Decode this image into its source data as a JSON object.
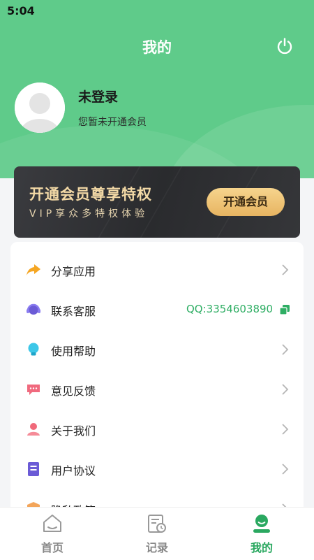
{
  "status_bar": {
    "time": "5:04"
  },
  "header": {
    "title": "我的"
  },
  "profile": {
    "name": "未登录",
    "subtitle": "您暂未开通会员"
  },
  "vip_banner": {
    "title": "开通会员尊享特权",
    "subtitle": "VIP享众多特权体验",
    "button_label": "开通会员"
  },
  "menu": {
    "items": [
      {
        "label": "分享应用",
        "icon": "share-arrow-icon"
      },
      {
        "label": "联系客服",
        "icon": "headset-icon",
        "extra": "QQ:3354603890"
      },
      {
        "label": "使用帮助",
        "icon": "lightbulb-icon"
      },
      {
        "label": "意见反馈",
        "icon": "chat-bubble-icon"
      },
      {
        "label": "关于我们",
        "icon": "person-icon"
      },
      {
        "label": "用户协议",
        "icon": "document-icon"
      },
      {
        "label": "隐私政策",
        "icon": "shield-icon"
      }
    ]
  },
  "tabbar": {
    "tabs": [
      {
        "label": "首页",
        "icon": "home-icon"
      },
      {
        "label": "记录",
        "icon": "record-icon"
      },
      {
        "label": "我的",
        "icon": "profile-icon",
        "active": true
      }
    ]
  },
  "colors": {
    "header_bg": "#5fcb8a",
    "accent_green": "#2aa860",
    "vip_gold": "#f3d9a6"
  }
}
